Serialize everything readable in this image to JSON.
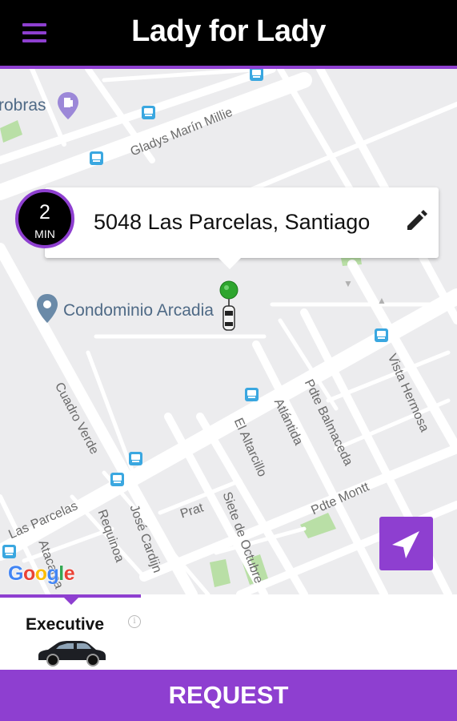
{
  "header": {
    "title": "Lady for Lady",
    "menu_icon": "hamburger-menu-icon"
  },
  "map": {
    "street_labels": {
      "gladys": "Gladys Marín Millie",
      "cuadro_verde": "Cuadro Verde",
      "el_altarcillo": "El Altarcillo",
      "atlantida": "Atlántida",
      "pdte_balmaceda": "Pdte Balmaceda",
      "vista_hermosa": "Vista Hermosa",
      "las_parcelas": "Las Parcelas",
      "requinoa": "Requinoa",
      "jose_cardijn": "José Cardijn",
      "prat": "Prat",
      "siete_de_octubre": "Siete de Octubre",
      "pdte_montt": "Pdte Montt",
      "atacama": "Atacama"
    },
    "poi": {
      "petrobras": "robras",
      "condominio": "Condominio Arcadia"
    },
    "google_logo": "Google",
    "colors": {
      "background": "#ececee",
      "road": "#ffffff",
      "park": "#b9dfa6",
      "transit": "#3aa7e0"
    }
  },
  "pickup": {
    "address": "5048 Las Parcelas, Santiago",
    "eta_value": "2",
    "eta_unit": "MIN",
    "edit_icon": "pencil-icon"
  },
  "locate_button": {
    "icon": "navigation-arrow-icon"
  },
  "vehicle": {
    "selected": "Executive",
    "info_glyph": "i",
    "car_icon": "sedan-car-icon"
  },
  "request_button": {
    "label": "REQUEST"
  },
  "theme": {
    "accent": "#8e3fd0",
    "header_bg": "#000000",
    "pin_color": "#2ea52e"
  }
}
